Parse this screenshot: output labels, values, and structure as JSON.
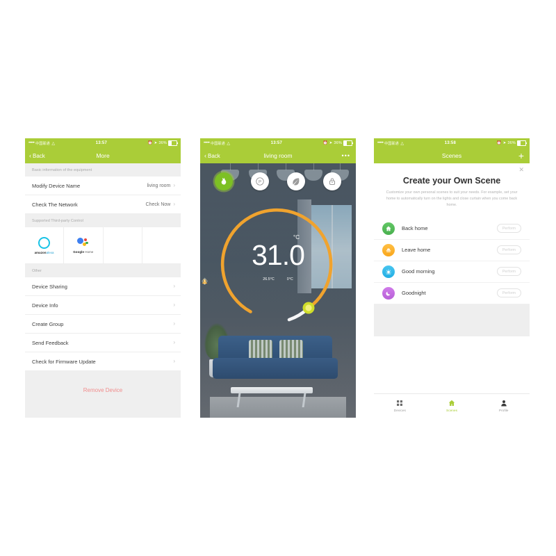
{
  "colors": {
    "brand_green": "#aacd38",
    "active_green": "#7dc024",
    "dial_orange": "#f0a32e",
    "danger_red": "#f08c8c",
    "power_red": "#c01f14"
  },
  "phone1": {
    "status": {
      "signal_dots": "•••••",
      "carrier": "中国联通",
      "wifi_icon": "wifi-icon",
      "time": "13:57",
      "battery_pct": "36%"
    },
    "nav": {
      "back_label": "Back",
      "title": "More"
    },
    "sections": [
      {
        "header": "Basic information of the equipment",
        "rows": [
          {
            "label": "Modify Device Name",
            "value": "living room"
          },
          {
            "label": "Check The Network",
            "value": "Check Now"
          }
        ]
      },
      {
        "header": "Supported Third-party Control",
        "third_party": [
          {
            "icon": "amazon-alexa-icon",
            "brand": "amazon",
            "product": "alexa"
          },
          {
            "icon": "google-home-icon",
            "brand": "Google",
            "product": "Home"
          }
        ]
      },
      {
        "header": "Other",
        "rows": [
          {
            "label": "Device Sharing",
            "value": ""
          },
          {
            "label": "Device Info",
            "value": ""
          },
          {
            "label": "Create Group",
            "value": ""
          },
          {
            "label": "Send Feedback",
            "value": ""
          },
          {
            "label": "Check for Firmware Update",
            "value": ""
          }
        ]
      }
    ],
    "remove_device_label": "Remove Device"
  },
  "phone2": {
    "status": {
      "signal_dots": "•••••",
      "carrier": "中国联通",
      "time": "13:57",
      "battery_pct": "36%"
    },
    "nav": {
      "back_label": "Back",
      "title": "living room",
      "more_label": "•••"
    },
    "modes": [
      {
        "name": "manual-mode-icon",
        "label": "Manual",
        "active": true
      },
      {
        "name": "program-mode-icon",
        "label": "Program",
        "active": false
      },
      {
        "name": "eco-mode-icon",
        "label": "Eco",
        "active": false
      },
      {
        "name": "lock-mode-icon",
        "label": "Lock",
        "active": false
      }
    ],
    "thermostat": {
      "setpoint": "31.0",
      "unit": "°C",
      "room_temp": "26.5°C",
      "floor_temp": "0°C",
      "room_temp_icon": "thermometer-icon",
      "floor_temp_icon": "heating-flame-icon"
    },
    "power_button": "power-icon"
  },
  "phone3": {
    "status": {
      "signal_dots": "•••••",
      "carrier": "中国联通",
      "time": "13:58",
      "battery_pct": "36%"
    },
    "nav": {
      "title": "Scenes",
      "add_label": "+"
    },
    "close_label": "✕",
    "title": "Create your Own Scene",
    "description": "Customize your own personal scenes to suit your needs. For example, set your home to automatically turn on the lights and close curtain when you come back home.",
    "scenes": [
      {
        "name": "Back home",
        "icon": "home-icon",
        "action": "Perform"
      },
      {
        "name": "Leave home",
        "icon": "door-icon",
        "action": "Perform"
      },
      {
        "name": "Good morning",
        "icon": "sun-icon",
        "action": "Perform"
      },
      {
        "name": "Goodnight",
        "icon": "moon-icon",
        "action": "Perform"
      }
    ],
    "tabs": [
      {
        "label": "Devices",
        "icon": "grid-icon",
        "active": false
      },
      {
        "label": "Scenes",
        "icon": "home-icon",
        "active": true
      },
      {
        "label": "Profile",
        "icon": "person-icon",
        "active": false
      }
    ]
  }
}
